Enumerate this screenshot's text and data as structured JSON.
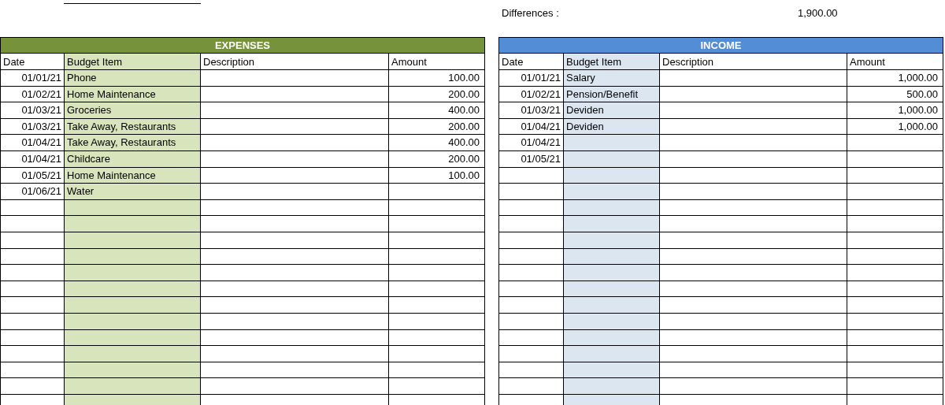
{
  "summary": {
    "label": "Differences :",
    "value": "1,900.00"
  },
  "tables": [
    {
      "title": "EXPENSES",
      "kind": "expenses",
      "columns": [
        "Date",
        "Budget Item",
        "Description",
        "Amount"
      ],
      "rows": [
        {
          "date": "01/01/21",
          "item": "Phone",
          "amount": "100.00"
        },
        {
          "date": "01/02/21",
          "item": "Home Maintenance",
          "amount": "200.00"
        },
        {
          "date": "01/03/21",
          "item": "Groceries",
          "amount": "400.00"
        },
        {
          "date": "01/03/21",
          "item": "Take Away, Restaurants",
          "amount": "200.00"
        },
        {
          "date": "01/04/21",
          "item": "Take Away, Restaurants",
          "amount": "400.00"
        },
        {
          "date": "01/04/21",
          "item": "Childcare",
          "amount": "200.00"
        },
        {
          "date": "01/05/21",
          "item": "Home Maintenance",
          "amount": "100.00"
        },
        {
          "date": "01/06/21",
          "item": "Water"
        }
      ]
    },
    {
      "title": "INCOME",
      "kind": "income",
      "columns": [
        "Date",
        "Budget Item",
        "Description",
        "Amount"
      ],
      "rows": [
        {
          "date": "01/01/21",
          "item": "Salary",
          "amount": "1,000.00"
        },
        {
          "date": "01/02/21",
          "item": "Pension/Benefit",
          "amount": "500.00"
        },
        {
          "date": "01/03/21",
          "item": "Deviden",
          "amount": "1,000.00"
        },
        {
          "date": "01/04/21",
          "item": "Deviden",
          "amount": "1,000.00"
        },
        {
          "date": "01/04/21"
        },
        {
          "date": "01/05/21"
        }
      ]
    }
  ]
}
